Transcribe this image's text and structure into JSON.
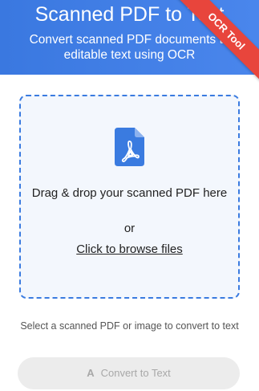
{
  "header": {
    "title": "Scanned PDF to Text",
    "subtitle": "Convert scanned PDF documents to editable text using OCR",
    "ribbon": "OCR Tool",
    "colors": {
      "gradient_start": "#3a78e0",
      "gradient_end": "#4a86ec",
      "ribbon": "#e8453c"
    }
  },
  "dropzone": {
    "icon": "pdf-file-icon",
    "instruction": "Drag & drop your scanned PDF here",
    "or": "or",
    "browse_label": "Click to browse files",
    "colors": {
      "border": "#3a7be0",
      "background": "#f3f7fd",
      "icon": "#3a7be0"
    }
  },
  "helper_text": "Select a scanned PDF or image to convert to text",
  "convert_button": {
    "icon": "text-font-icon",
    "icon_glyph": "A",
    "label": "Convert to Text",
    "state": "disabled"
  }
}
